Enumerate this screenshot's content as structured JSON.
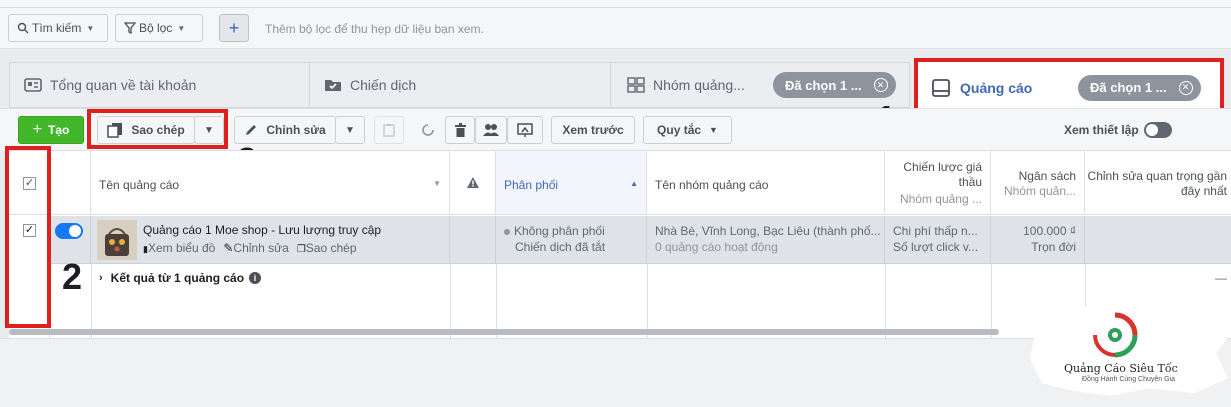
{
  "filter_bar": {
    "search_label": "Tìm kiếm",
    "filter_label": "Bộ lọc",
    "add_label": "+",
    "hint": "Thêm bộ lọc để thu hẹp dữ liệu bạn xem."
  },
  "tabs": {
    "overview": "Tổng quan về tài khoản",
    "campaigns": "Chiến dịch",
    "adsets": "Nhóm quảng...",
    "adsets_chip": "Đã chọn 1 ...",
    "ads": "Quảng cáo",
    "ads_chip": "Đã chọn 1 ..."
  },
  "toolbar": {
    "create": "Tạo",
    "duplicate": "Sao chép",
    "edit": "Chỉnh sửa",
    "preview": "Xem trước",
    "rules": "Quy tắc",
    "view_setup": "Xem thiết lập"
  },
  "table": {
    "headers": {
      "ad_name": "Tên quảng cáo",
      "delivery": "Phân phối",
      "adset_name": "Tên nhóm quảng cáo",
      "bid_strategy": "Chiến lược giá thầu",
      "bid_strategy_sub": "Nhóm quảng ...",
      "budget": "Ngân sách",
      "budget_sub": "Nhóm quản...",
      "last_edit": "Chỉnh sửa quan trọng gần đây nhất"
    },
    "row": {
      "ad_name": "Quảng cáo 1 Moe shop - Lưu lượng truy cập",
      "action_chart": "Xem biểu đồ",
      "action_edit": "Chỉnh sửa",
      "action_dup": "Sao chép",
      "delivery": "Không phân phối",
      "delivery_sub": "Chiến dịch đã tắt",
      "adset": "Nhà Bè, Vĩnh Long, Bạc Liêu (thành phố...",
      "adset_sub": "0 quảng cáo hoạt động",
      "bid": "Chi phí thấp n...",
      "bid_sub": "Số lượt click v...",
      "budget": "100.000 ₫",
      "budget_sub": "Trọn đời"
    },
    "results": "Kết quả từ 1 quảng cáo",
    "last_dash": "—"
  },
  "annotations": {
    "n1": "1",
    "n2": "2",
    "n3": "3"
  },
  "logo": {
    "name": "Quảng Cáo Siêu Tốc",
    "tagline": "Đồng Hành Cùng Chuyên Gia"
  },
  "colors": {
    "highlight": "#e0201c",
    "brand_blue": "#4267b2",
    "create_green": "#42b72a",
    "toggle_blue": "#1877f2"
  }
}
